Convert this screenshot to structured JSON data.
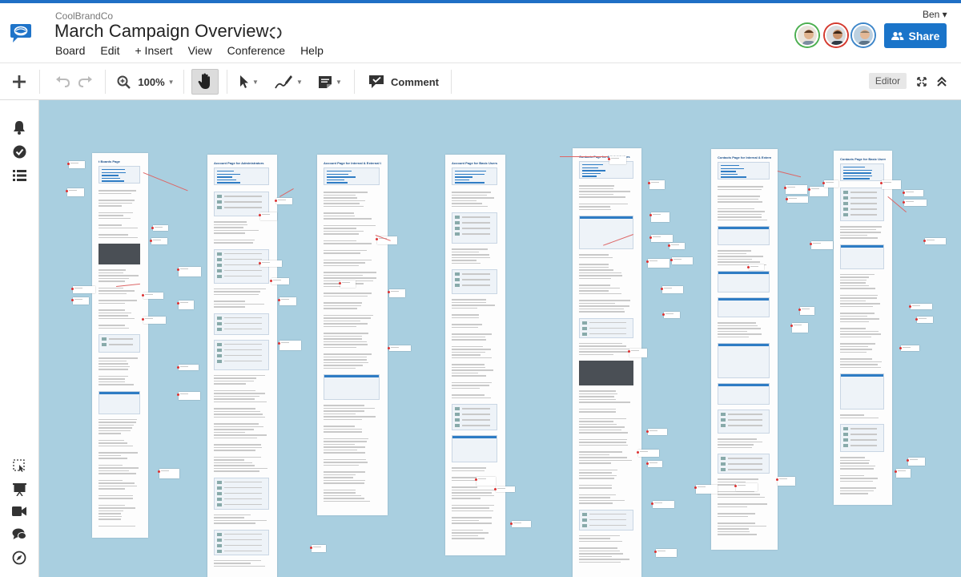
{
  "app": {
    "org_name": "CoolBrandCo",
    "doc_title": "March Campaign Overview",
    "menu": [
      "Board",
      "Edit",
      "+ Insert",
      "View",
      "Conference",
      "Help"
    ],
    "user_name": "Ben ▾",
    "share_label": "Share"
  },
  "toolbar": {
    "zoom": "100%",
    "comment_label": "Comment",
    "mode_badge": "Editor"
  },
  "canvas": {
    "pages": [
      {
        "title": "t Boards Page"
      },
      {
        "title": "Account Page for Administrators"
      },
      {
        "title": "Account Page for Internal & External Users"
      },
      {
        "title": "Account Page for Basic Users"
      },
      {
        "title": "Contacts Page for Administrators"
      },
      {
        "title": "Contacts Page for Internal & External Users"
      },
      {
        "title": "Contacts Page for Basic Users"
      }
    ]
  },
  "colors": {
    "brand_blue": "#1a74c9",
    "canvas_bg": "#a9cfe0",
    "top_stripe": "#1f6fc5"
  },
  "icons": {
    "logo": "chat-bubble-logo-icon",
    "sync": "sync-icon",
    "add": "plus-icon",
    "undo": "undo-icon",
    "redo": "redo-icon",
    "zoom": "magnifier-icon",
    "hand": "hand-icon",
    "select": "cursor-icon",
    "pen": "pen-icon",
    "note": "sticky-note-icon",
    "comment": "comment-icon",
    "fullscreen": "expand-icon",
    "collapse": "chevron-up-icon",
    "rail": [
      "bell-icon",
      "check-circle-icon",
      "list-icon",
      "select-area-icon",
      "presentation-icon",
      "video-icon",
      "chat-icon",
      "compass-icon"
    ]
  }
}
